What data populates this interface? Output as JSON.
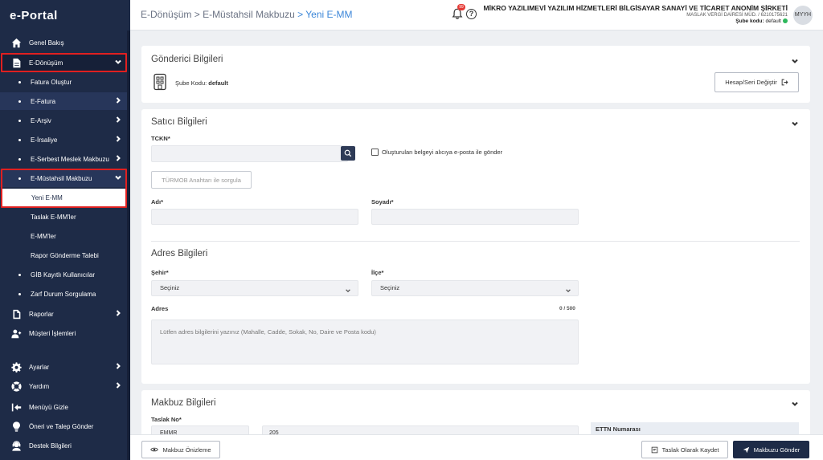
{
  "app": {
    "logo_text": "e-Portal"
  },
  "sidebar": {
    "items": [
      {
        "label": "Genel Bakış",
        "icon": "home-icon"
      },
      {
        "label": "E-Dönüşüm",
        "icon": "document-icon"
      },
      {
        "label": "Fatura Oluştur"
      },
      {
        "label": "E-Fatura"
      },
      {
        "label": "E-Arşiv"
      },
      {
        "label": "E-İrsaliye"
      },
      {
        "label": "E-Serbest Meslek Makbuzu"
      },
      {
        "label": "E-Müstahsil Makbuzu"
      },
      {
        "label": "Yeni E-MM"
      },
      {
        "label": "Taslak E-MM'ler"
      },
      {
        "label": "E-MM'ler"
      },
      {
        "label": "Rapor Gönderme Talebi"
      },
      {
        "label": "GİB Kayıtlı Kullanıcılar"
      },
      {
        "label": "Zarf Durum Sorgulama"
      },
      {
        "label": "Raporlar",
        "icon": "report-icon"
      },
      {
        "label": "Müşteri İşlemleri",
        "icon": "users-icon"
      },
      {
        "label": "Ayarlar",
        "icon": "gear-icon"
      },
      {
        "label": "Yardım",
        "icon": "lifebuoy-icon"
      },
      {
        "label": "Menüyü Gizle",
        "icon": "collapse-menu-icon"
      },
      {
        "label": "Öneri ve Talep Gönder",
        "icon": "lightbulb-icon"
      },
      {
        "label": "Destek Bilgileri",
        "icon": "support-icon"
      }
    ]
  },
  "header": {
    "breadcrumb": [
      "E-Dönüşüm",
      "E-Müstahsil Makbuzu",
      "Yeni E-MM"
    ],
    "separator": ">",
    "notification_count": "99",
    "help_glyph": "?",
    "company_name": "MİKRO YAZILIMEVİ YAZILIM HİZMETLERİ BİLGİSAYAR SANAYİ VE TİCARET ANONİM ŞİRKETİ",
    "tax_info": "MASLAK VERGİ DAİRESİ MÜD. / 6210175621",
    "branch_label": "Şube kodu:",
    "branch_value": "default",
    "avatar_initials": "MYYH"
  },
  "sender": {
    "title": "Gönderici Bilgileri",
    "branch_label": "Şube Kodu:",
    "branch_value": "default",
    "change_button": "Hesap/Seri Değiştir"
  },
  "seller": {
    "title": "Satıcı Bilgileri",
    "tckn_label": "TCKN*",
    "email_checkbox_label": "Oluşturulan belgeyi alıcıya e-posta ile gönder",
    "turmob_button": "TÜRMOB Anahtarı ile sorgula",
    "name_label": "Adı*",
    "surname_label": "Soyadı*"
  },
  "address": {
    "title": "Adres Bilgileri",
    "city_label": "Şehir*",
    "city_value": "Seçiniz",
    "district_label": "İlçe*",
    "district_value": "Seçiniz",
    "address_label": "Adres",
    "counter": "0 / 500",
    "placeholder": "Lütfen adres bilgilerini yazınız (Mahalle, Cadde, Sokak, No, Daire ve Posta kodu)"
  },
  "receipt": {
    "title": "Makbuz Bilgileri",
    "draft_no_label": "Taslak No*",
    "prefix_value": "EMMR",
    "number_value": "205",
    "ettn_label": "ETTN Numarası"
  },
  "footer": {
    "preview_button": "Makbuz Önizleme",
    "save_draft_button": "Taslak Olarak Kaydet",
    "send_button": "Makbuzu Gönder"
  }
}
